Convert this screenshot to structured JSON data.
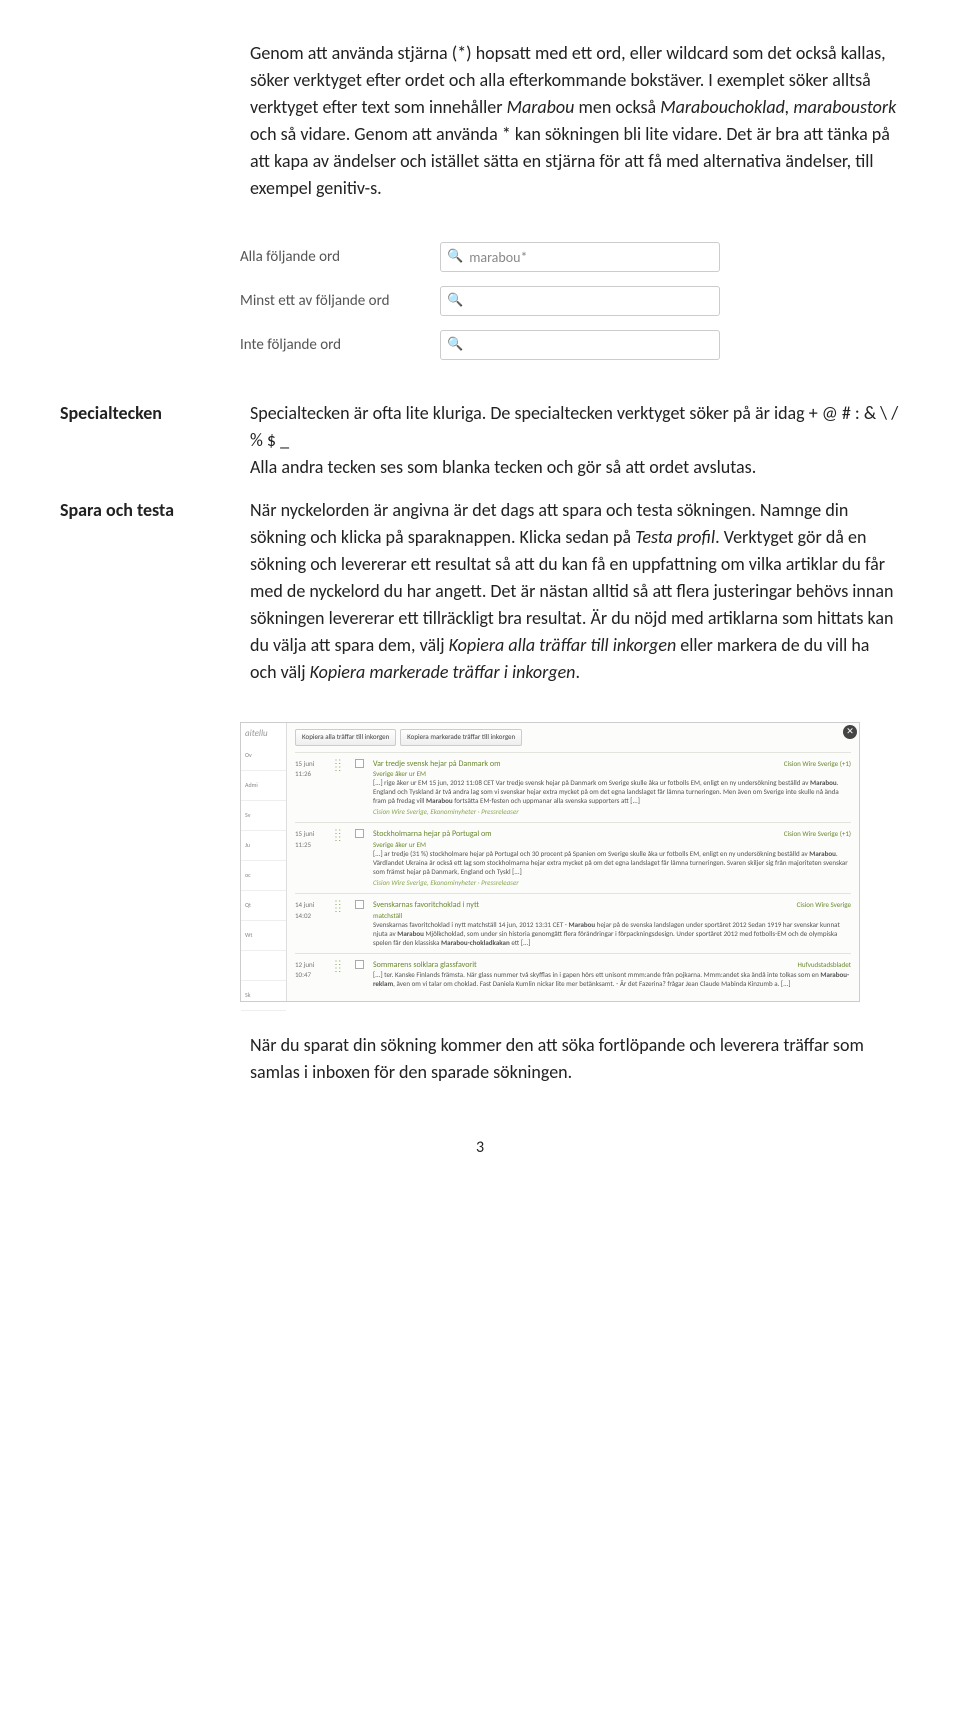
{
  "intro_para": "Genom att använda stjärna (*) hopsatt med ett ord, eller wildcard som det också kallas, söker verktyget efter ordet och alla efterkommande bokstäver. I exemplet söker alltså verktyget efter text som innehåller Marabou men också Marabouchoklad, maraboustork och så vidare. Genom att använda * kan sökningen bli lite vidare. Det är bra att tänka på att kapa av ändelser och istället sätta en stjärna för att få med alternativa ändelser, till exempel genitiv-s.",
  "intro_italic1": "Marabou",
  "intro_italic2": "Marabouchoklad, maraboustork",
  "search_form": {
    "row1_label": "Alla följande ord",
    "row1_value": "marabou*",
    "row2_label": "Minst ett av följande ord",
    "row3_label": "Inte följande ord"
  },
  "sections": {
    "specialtecken": {
      "label": "Specialtecken",
      "text": "Specialtecken är ofta lite kluriga. De specialtecken verktyget söker på är idag + @ # : & \\ / % $ _\nAlla andra tecken ses som blanka tecken och gör så att ordet avslutas."
    },
    "spara": {
      "label": "Spara och testa",
      "part1": "När nyckelorden är angivna är det dags att spara och testa sökningen. Namnge din sökning och klicka på sparaknappen. Klicka sedan på ",
      "italic1": "Testa profil",
      "part2": ". Verktyget gör då en sökning och levererar ett resultat så att du kan få en uppfattning om vilka artiklar du får med de nyckelord du har angett. Det är nästan alltid så att flera justeringar behövs innan sökningen levererar ett tillräckligt bra resultat. Är du nöjd med artiklarna som hittats kan du välja att spara dem, välj ",
      "italic2": "Kopiera alla träffar till inkorgen",
      "part3": " eller markera de du vill ha och välj ",
      "italic3": "Kopiera markerade träffar i inkorgen",
      "part4": "."
    }
  },
  "screenshot": {
    "brand": "aitellu",
    "btn1": "Kopiera alla träffar till inkorgen",
    "btn2": "Kopiera markerade träffar till inkorgen",
    "left_items": [
      "Ov",
      "Admi",
      "Sv",
      "Ju",
      "oc",
      "Qt",
      "Wt",
      "",
      "Sk"
    ],
    "articles": [
      {
        "date": "15 juni",
        "time": "11:26",
        "title": "Var tredje svensk hejar på Danmark om",
        "sub": "Sverige åker ur EM",
        "src": "Cision Wire Sverige (+1)",
        "body": "[...] rige åker ur EM 15 jun, 2012 11:08 CET Var tredje svensk hejar på Danmark om Sverige skulle åka ur fotbolls EM, enligt en ny undersökning beställd av Marabou. England och Tyskland är två andra lag som vi svenskar hejar extra mycket på om det egna landslaget får lämna turneringen. Men även om Sverige inte skulle nå ända fram på fredag vill Marabou fortsätta EM-festen och uppmanar alla svenska supporters att [...]",
        "meta": "Cision Wire Sverige, Ekonominyheter · Pressreleaser"
      },
      {
        "date": "15 juni",
        "time": "11:25",
        "title": "Stockholmarna hejar på Portugal om",
        "sub": "Sverige åker ur EM",
        "src": "Cision Wire Sverige (+1)",
        "body": "[...] ar tredje (31 %) stockholmare hejar på Portugal och 30 procent på Spanien om Sverige skulle åka ur fotbolls EM, enligt en ny undersökning beställd av Marabou. Värdlandet Ukraina är också ett lag som stockholmarna hejar extra mycket på om det egna landslaget får lämna turneringen. Svaren skiljer sig från majoriteten svenskar som främst hejar på Danmark, England och Tyskl [...]",
        "meta": "Cision Wire Sverige, Ekonominyheter · Pressreleaser"
      },
      {
        "date": "14 juni",
        "time": "14:02",
        "title": "Svenskarnas favoritchoklad i nytt",
        "sub": "matchställ",
        "src": "Cision Wire Sverige",
        "body": "Svenskarnas favoritchoklad i nytt matchställ 14 jun, 2012 13:31 CET - Marabou hejar på de svenska landslagen under sportåret 2012 Sedan 1919 har svenskar kunnat njuta av Marabou Mjölkchoklad, som under sin historia genomgått flera förändringar i förpackningsdesign. Under sportåret 2012 med fotbolls-EM och de olympiska spelen får den klassiska Marabou-chokladkakan ett [...]",
        "meta": ""
      },
      {
        "date": "12 juni",
        "time": "10:47",
        "title": "Sommarens solklara glassfavorit",
        "sub": "",
        "src": "Hufvudstadsbladet",
        "body": "[...] ter. Kanske Finlands främsta. När glass nummer två skyfflas in i gapen hörs ett unisont mmm:ande från pojkarna. Mmm:andet ska ändå inte tolkas som en Marabou-reklam, även om vi talar om choklad. Fast Daniela Kumlin nickar lite mer betänksamt. - Är det Fazerina? frågar Jean Claude Mabinda Kinzumb a. [...]",
        "meta": ""
      }
    ]
  },
  "closing": "När du sparat din sökning kommer den att söka fortlöpande och leverera träffar som samlas i inboxen för den sparade sökningen.",
  "page_number": "3"
}
